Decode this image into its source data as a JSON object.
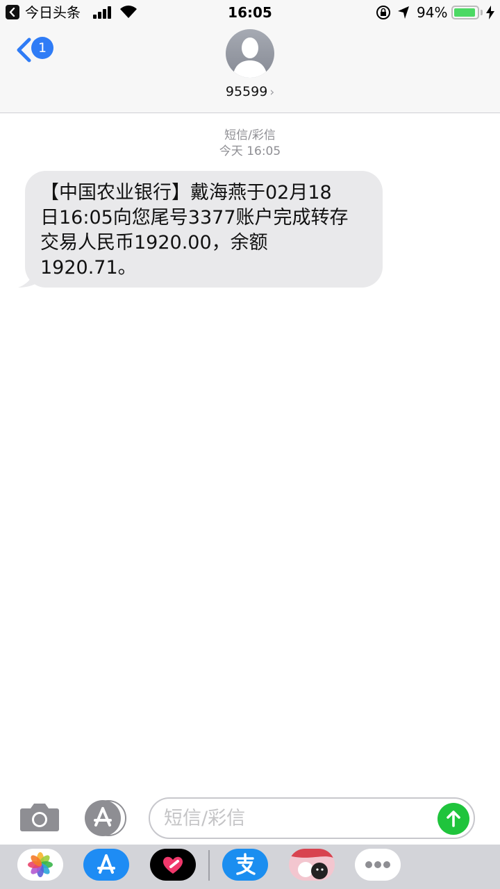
{
  "status_bar": {
    "back_app_name": "今日头条",
    "time": "16:05",
    "battery_percent": "94%",
    "battery_level": 0.94,
    "icons": [
      "back-arrow-icon",
      "signal-icon",
      "wifi-icon",
      "rotation-lock-icon",
      "location-icon",
      "battery-icon",
      "charging-icon"
    ]
  },
  "header": {
    "unread_count": "1",
    "contact_name": "95599",
    "contact_chevron": "›"
  },
  "conversation": {
    "service_label": "短信/彩信",
    "timestamp": "今天 16:05",
    "messages": [
      {
        "lines": [
          "【中国农业银行】戴海燕于02月18",
          "日16:05向您尾号3377账户完成转存",
          "交易人民币1920.00，余额",
          "1920.71。"
        ]
      }
    ]
  },
  "composer": {
    "placeholder": "短信/彩信",
    "value": ""
  },
  "app_drawer": {
    "apps": [
      "photos-app-icon",
      "app-store-app-icon",
      "digital-touch-app-icon",
      "alipay-app-icon",
      "sticker-app-icon",
      "more-apps-icon"
    ]
  },
  "colors": {
    "accent_blue": "#2f7cf6",
    "send_green": "#1fc43c",
    "bubble_gray": "#e9e9eb",
    "battery_green": "#4cd964"
  }
}
